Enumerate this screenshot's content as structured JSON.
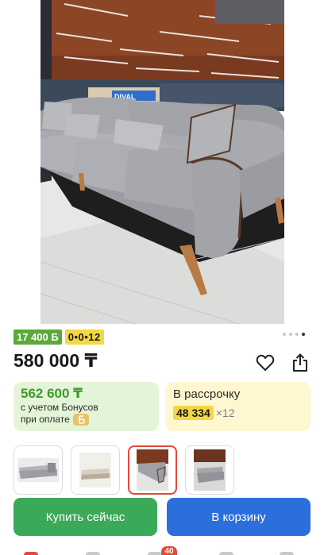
{
  "product": {
    "badges": {
      "bonus": "17 400 Б",
      "installment": "0•0•12"
    },
    "carousel": {
      "count": 4,
      "active_index": 3
    },
    "price": "580 000 ₸"
  },
  "bonus_card": {
    "price": "562 600 ₸",
    "note_line1": "с учетом Бонусов",
    "note_line2": "при оплате"
  },
  "installment_card": {
    "title": "В рассрочку",
    "amount": "48 334",
    "times": "×12"
  },
  "photo": {
    "store_sign": "DIVAL"
  },
  "thumbnails": [
    {
      "name": "thumb-sofa-side",
      "active": false
    },
    {
      "name": "thumb-sofa-front",
      "active": false
    },
    {
      "name": "thumb-sofa-showroom",
      "active": true
    },
    {
      "name": "thumb-sofa-hall",
      "active": false
    }
  ],
  "actions": {
    "buy_now": "Купить сейчас",
    "add_to_cart": "В корзину"
  },
  "bottom_nav": {
    "cart_count": "40"
  },
  "colors": {
    "bonus_green": "#5aa93a",
    "installment_yellow": "#f5d743",
    "buy_green": "#3aaa58",
    "cart_blue": "#2b6fdc",
    "active_red": "#e3493b"
  },
  "icons": [
    "heart-icon",
    "share-icon",
    "bonus-coin-icon"
  ]
}
